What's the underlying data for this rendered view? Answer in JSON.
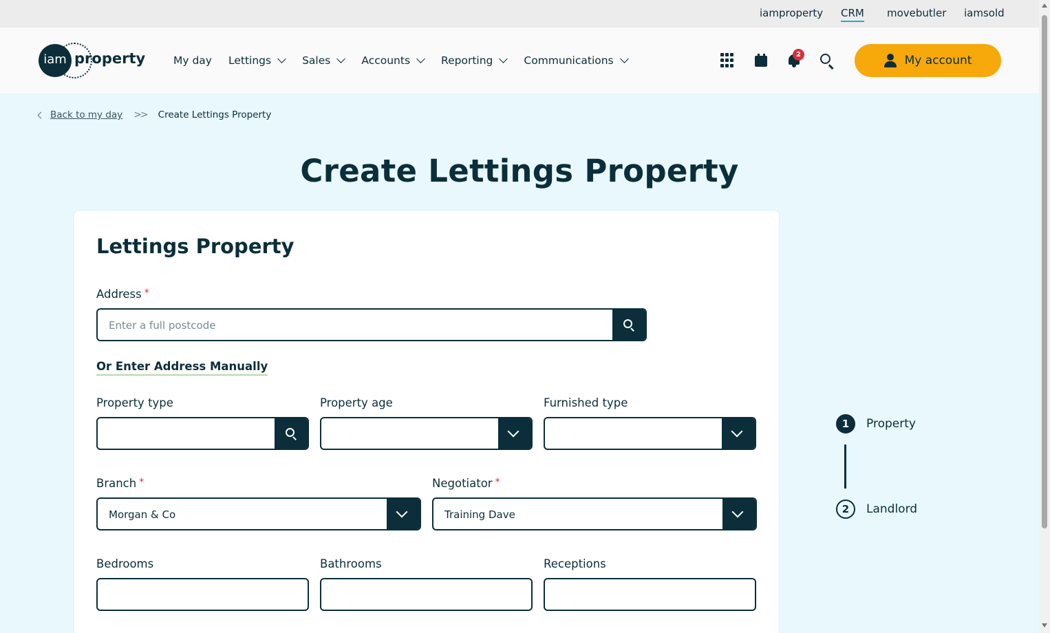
{
  "util_links": [
    "iamproperty",
    "CRM",
    "movebutler",
    "iamsold"
  ],
  "logo": {
    "circle": "iam",
    "text": "property"
  },
  "nav": {
    "items": [
      {
        "label": "My day",
        "dropdown": false
      },
      {
        "label": "Lettings",
        "dropdown": true
      },
      {
        "label": "Sales",
        "dropdown": true
      },
      {
        "label": "Accounts",
        "dropdown": true
      },
      {
        "label": "Reporting",
        "dropdown": true
      },
      {
        "label": "Communications",
        "dropdown": true
      }
    ]
  },
  "header_icons": [
    "apps-grid-icon",
    "calendar-icon",
    "bell-icon",
    "search-icon"
  ],
  "notifications": {
    "count": "2"
  },
  "account": {
    "label": "My account"
  },
  "breadcrumb": {
    "back": "Back to my day",
    "current": "Create Lettings Property"
  },
  "page": {
    "title": "Create Lettings Property"
  },
  "form": {
    "heading": "Lettings Property",
    "address": {
      "label": "Address",
      "placeholder": "Enter a full postcode",
      "required": "*"
    },
    "manual_link": "Or Enter Address Manually",
    "property_type": {
      "label": "Property type",
      "value": ""
    },
    "property_age": {
      "label": "Property age",
      "value": ""
    },
    "furnished_type": {
      "label": "Furnished type",
      "value": ""
    },
    "branch": {
      "label": "Branch",
      "value": "Morgan & Co",
      "required": "*"
    },
    "negotiator": {
      "label": "Negotiator",
      "value": "Training Dave",
      "required": "*"
    },
    "bedrooms": {
      "label": "Bedrooms",
      "value": ""
    },
    "bathrooms": {
      "label": "Bathrooms",
      "value": ""
    },
    "receptions": {
      "label": "Receptions",
      "value": ""
    }
  },
  "stepper": [
    {
      "num": "1",
      "label": "Property",
      "active": true
    },
    {
      "num": "2",
      "label": "Landlord",
      "active": false
    }
  ],
  "colors": {
    "primary": "#0b2e3a",
    "accent": "#f7a90b",
    "background": "#e8f8fc",
    "badge": "#d92d3a"
  }
}
